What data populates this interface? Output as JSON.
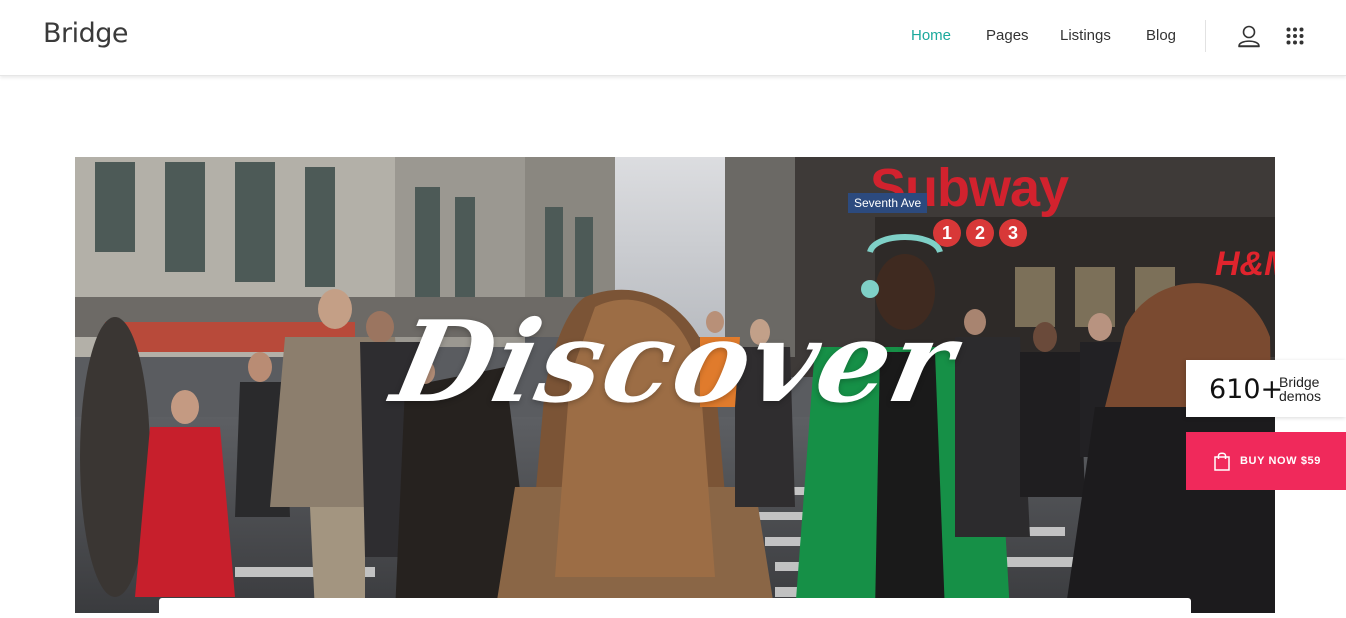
{
  "header": {
    "logo": "Bridge",
    "nav": [
      {
        "label": "Home",
        "active": true
      },
      {
        "label": "Pages",
        "active": false
      },
      {
        "label": "Listings",
        "active": false
      },
      {
        "label": "Blog",
        "active": false
      }
    ],
    "icons": [
      "user-icon",
      "grid-icon"
    ],
    "accent_color": "#1ba99c"
  },
  "hero": {
    "title": "Discover",
    "scene_text": {
      "subway_sign": "Subway",
      "street_sign": "Seventh Ave",
      "store_sign": "H&M",
      "line_badges": [
        "1",
        "2",
        "3"
      ]
    }
  },
  "side_widgets": {
    "demos_count": "610+",
    "demos_label": "Bridge demos",
    "buy_label": "BUY NOW $59",
    "buy_color": "#f0295b",
    "buy_icon": "shopping-bag-icon"
  }
}
